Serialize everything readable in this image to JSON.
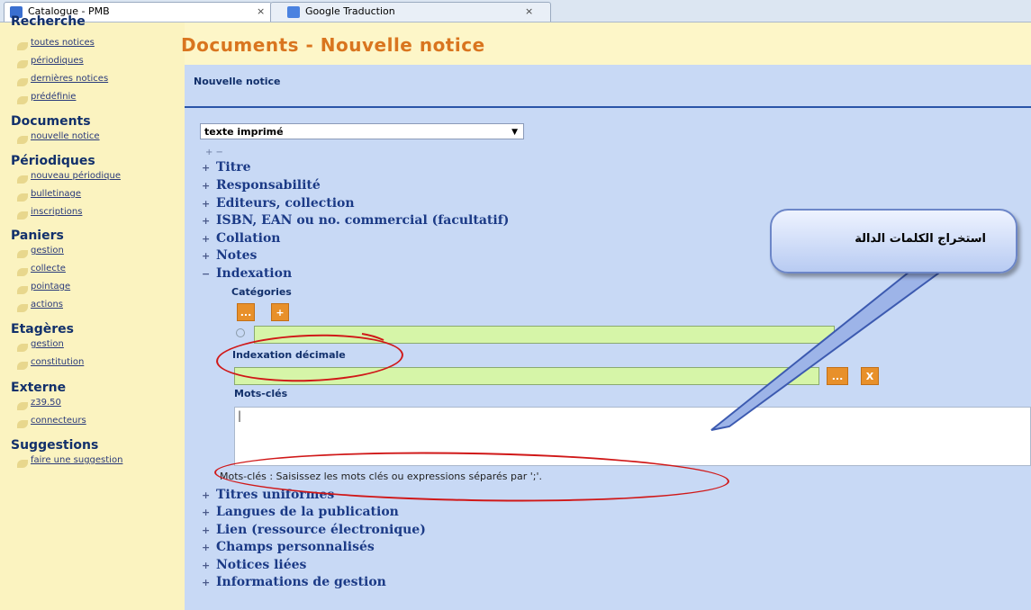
{
  "tabs": [
    {
      "label": "Catalogue - PMB",
      "close": "×"
    },
    {
      "label": "Google Traduction",
      "close": "×"
    }
  ],
  "sidebar": {
    "sections": [
      {
        "title": "Recherche",
        "links": [
          "toutes notices",
          "périodiques",
          "dernières notices",
          "prédéfinie"
        ]
      },
      {
        "title": "Documents",
        "links": [
          "nouvelle notice"
        ]
      },
      {
        "title": "Périodiques",
        "links": [
          "nouveau périodique",
          "bulletinage",
          "inscriptions"
        ]
      },
      {
        "title": "Paniers",
        "links": [
          "gestion",
          "collecte",
          "pointage",
          "actions"
        ]
      },
      {
        "title": "Etagères",
        "links": [
          "gestion",
          "constitution"
        ]
      },
      {
        "title": "Externe",
        "links": [
          "z39.50",
          "connecteurs"
        ]
      },
      {
        "title": "Suggestions",
        "links": [
          "faire une suggestion"
        ]
      }
    ]
  },
  "page": {
    "title": "Documents - Nouvelle notice",
    "subtitle": "Nouvelle notice",
    "type_select": "texte imprimé",
    "expand_collapse": "+ −"
  },
  "fields_top": [
    {
      "sign": "+",
      "label": "Titre"
    },
    {
      "sign": "+",
      "label": "Responsabilité"
    },
    {
      "sign": "+",
      "label": "Editeurs, collection"
    },
    {
      "sign": "+",
      "label": "ISBN, EAN ou no. commercial (facultatif)"
    },
    {
      "sign": "+",
      "label": "Collation"
    },
    {
      "sign": "+",
      "label": "Notes"
    },
    {
      "sign": "−",
      "label": "Indexation"
    }
  ],
  "indexation": {
    "categories_label": "Catégories",
    "btn_browse": "...",
    "btn_add": "+",
    "decimal_label": "Indexation décimale",
    "btn_clear": "X",
    "keywords_label": "Mots-clés",
    "keywords_value": "|",
    "hint": "Mots-clés : Saisissez les mots clés ou expressions séparés par ';'."
  },
  "fields_bottom": [
    {
      "sign": "+",
      "label": "Titres uniformes"
    },
    {
      "sign": "+",
      "label": "Langues de la publication"
    },
    {
      "sign": "+",
      "label": "Lien (ressource électronique)"
    },
    {
      "sign": "+",
      "label": "Champs personnalisés"
    },
    {
      "sign": "+",
      "label": "Notices liées"
    },
    {
      "sign": "+",
      "label": "Informations de gestion"
    }
  ],
  "annotation": {
    "callout_text": "استخراج الكلمات الدالة",
    "color": "#d01818"
  }
}
